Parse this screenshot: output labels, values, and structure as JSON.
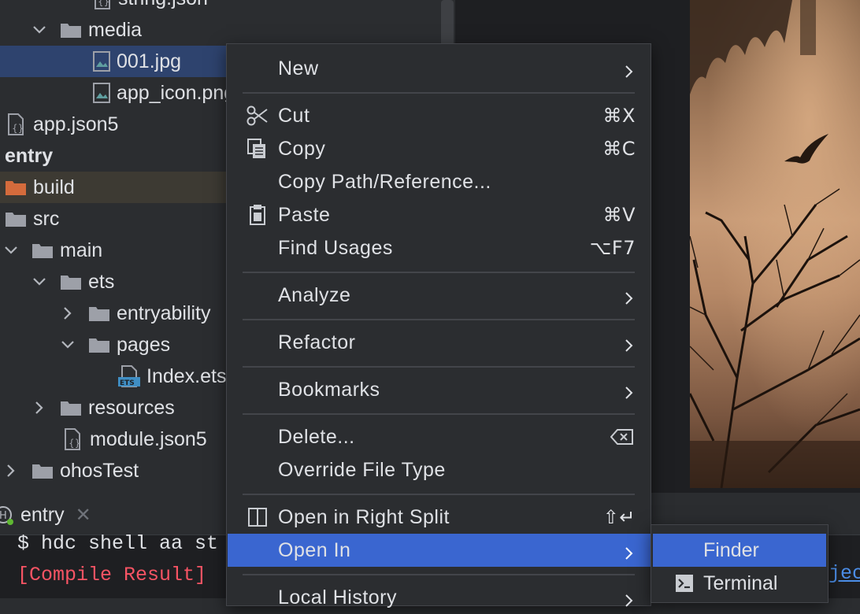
{
  "tree": {
    "items": [
      {
        "label": "string.json",
        "icon": "json-file-icon"
      },
      {
        "label": "media",
        "icon": "folder-icon",
        "expanded": true
      },
      {
        "label": "001.jpg",
        "icon": "image-file-icon",
        "selected": true
      },
      {
        "label": "app_icon.png",
        "icon": "image-file-icon"
      },
      {
        "label": "app.json5",
        "icon": "json-file-icon"
      },
      {
        "label": "entry",
        "icon": "",
        "bold": true
      },
      {
        "label": "build",
        "icon": "folder-excluded-icon"
      },
      {
        "label": "src",
        "icon": "folder-icon"
      },
      {
        "label": "main",
        "icon": "folder-icon",
        "expanded": true
      },
      {
        "label": "ets",
        "icon": "folder-icon",
        "expanded": true
      },
      {
        "label": "entryability",
        "icon": "folder-icon",
        "expanded": false
      },
      {
        "label": "pages",
        "icon": "folder-icon",
        "expanded": true
      },
      {
        "label": "Index.ets",
        "icon": "ets-file-icon"
      },
      {
        "label": "resources",
        "icon": "folder-icon",
        "expanded": false
      },
      {
        "label": "module.json5",
        "icon": "json-file-icon"
      },
      {
        "label": "ohosTest",
        "icon": "folder-icon",
        "expanded": false
      }
    ]
  },
  "bottom_panel": {
    "tab_label": "entry",
    "console": [
      {
        "text": "$ hdc shell aa st",
        "color": "#dfe1e5"
      },
      {
        "text": "[Compile Result]",
        "color": "#f75464"
      }
    ],
    "link_text": "jec"
  },
  "context_menu": {
    "items": [
      {
        "label": "New",
        "shortcut": "",
        "submenu": true,
        "icon": ""
      },
      {
        "label": "Cut",
        "shortcut": "⌘X",
        "submenu": false,
        "icon": "scissors-icon"
      },
      {
        "label": "Copy",
        "shortcut": "⌘C",
        "submenu": false,
        "icon": "copy-icon"
      },
      {
        "label": "Copy Path/Reference...",
        "shortcut": "",
        "submenu": false,
        "icon": ""
      },
      {
        "label": "Paste",
        "shortcut": "⌘V",
        "submenu": false,
        "icon": "clipboard-icon"
      },
      {
        "label": "Find Usages",
        "shortcut": "⌥F7",
        "submenu": false,
        "icon": ""
      },
      {
        "label": "Analyze",
        "shortcut": "",
        "submenu": true,
        "icon": ""
      },
      {
        "label": "Refactor",
        "shortcut": "",
        "submenu": true,
        "icon": ""
      },
      {
        "label": "Bookmarks",
        "shortcut": "",
        "submenu": true,
        "icon": ""
      },
      {
        "label": "Delete...",
        "shortcut": "",
        "submenu": false,
        "icon": "delete-key-icon"
      },
      {
        "label": "Override File Type",
        "shortcut": "",
        "submenu": false,
        "icon": ""
      },
      {
        "label": "Open in Right Split",
        "shortcut": "⇧↵",
        "submenu": false,
        "icon": "split-view-icon"
      },
      {
        "label": "Open In",
        "shortcut": "",
        "submenu": true,
        "icon": "",
        "highlighted": true
      },
      {
        "label": "Local History",
        "shortcut": "",
        "submenu": true,
        "icon": ""
      }
    ]
  },
  "submenu": {
    "items": [
      {
        "label": "Finder",
        "icon": "",
        "highlighted": true
      },
      {
        "label": "Terminal",
        "icon": "terminal-icon"
      }
    ]
  },
  "colors": {
    "selection": "#2e436e",
    "menu_highlight": "#3a66d0",
    "panel_bg": "#2b2d30",
    "editor_bg": "#1e1f22"
  }
}
